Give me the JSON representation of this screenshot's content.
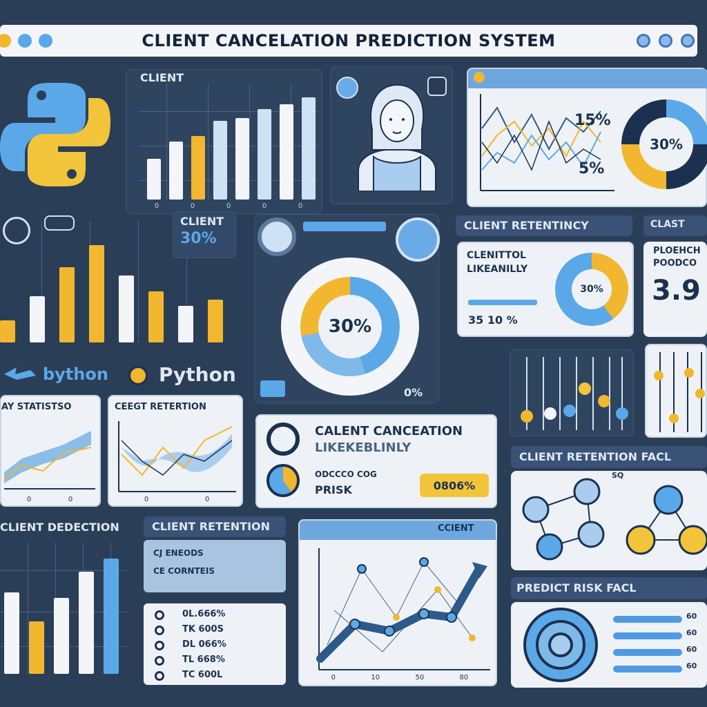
{
  "window": {
    "title": "CLIENT CANCELATION PREDICTION SYSTEM"
  },
  "colors": {
    "background": "#2b3e57",
    "accent_yellow": "#f2b72e",
    "accent_blue": "#5ba8e8",
    "light_panel": "#eef2f6",
    "navy": "#1c3150"
  },
  "top_chart": {
    "label": "CLIENT",
    "tick_labels": [
      "0",
      "0",
      "0",
      "0",
      "0"
    ],
    "values": [
      35,
      50,
      55,
      68,
      70,
      78,
      82,
      88
    ]
  },
  "avatar_panel": {
    "icon": "woman-avatar-icon"
  },
  "line_panel": {
    "stat_high": "15%",
    "stat_low": "5%",
    "donut_value": "30%"
  },
  "python_logo": {
    "icon": "python-logo-icon",
    "small_label": "bython",
    "label": "Python"
  },
  "mid_bars": {
    "values": [
      18,
      38,
      62,
      80,
      55,
      42,
      30,
      35
    ]
  },
  "client_badge": {
    "label": "CLIENT",
    "value": "30%"
  },
  "center_donut": {
    "value": "30%",
    "corner_value": "0%"
  },
  "retention_panel": {
    "header": "CLIENT RETENTINCY",
    "title_line1": "CLENITTOL",
    "title_line2": "LIKEANILLY",
    "footer": "35 10 %",
    "donut_value": "30%"
  },
  "right_stat": {
    "header": "CLAST",
    "line1": "PLOEHCH",
    "line2": "POODCO",
    "value": "3.9"
  },
  "stats_left": {
    "label": "AY STATISTSO",
    "tick_labels": [
      "0",
      "0"
    ]
  },
  "stats_mid": {
    "label": "CEEGT RETERTION",
    "tick_labels": [
      "0",
      "0"
    ]
  },
  "likelihood_card": {
    "title": "CALENT CANCEATION",
    "subtitle": "LIKEKEBLINLY",
    "sub_left": "ODCCCO COG",
    "risk_label": "PRISK",
    "risk_value": "0806%"
  },
  "retention_factors": {
    "header": "CLIENT RETENTION FACL",
    "note": "SQ"
  },
  "detection_panel": {
    "label": "CLIENT DEDECTION",
    "values": [
      62,
      40,
      58,
      78,
      88
    ]
  },
  "retention_list": {
    "label": "CLIENT RETENTION",
    "lines": [
      "CJ ENEODS",
      "CE CORNTEIS"
    ],
    "items": [
      "0L.666%",
      "TK 600S",
      "DL 066%",
      "TL 668%",
      "TC 600L"
    ]
  },
  "trend_panel": {
    "header": "CCIENT",
    "tick_labels": [
      "0",
      "10",
      "50",
      "80"
    ]
  },
  "risk_factors": {
    "header": "PREDICT RISK FACL",
    "items": [
      "60",
      "60",
      "60",
      "60"
    ]
  }
}
